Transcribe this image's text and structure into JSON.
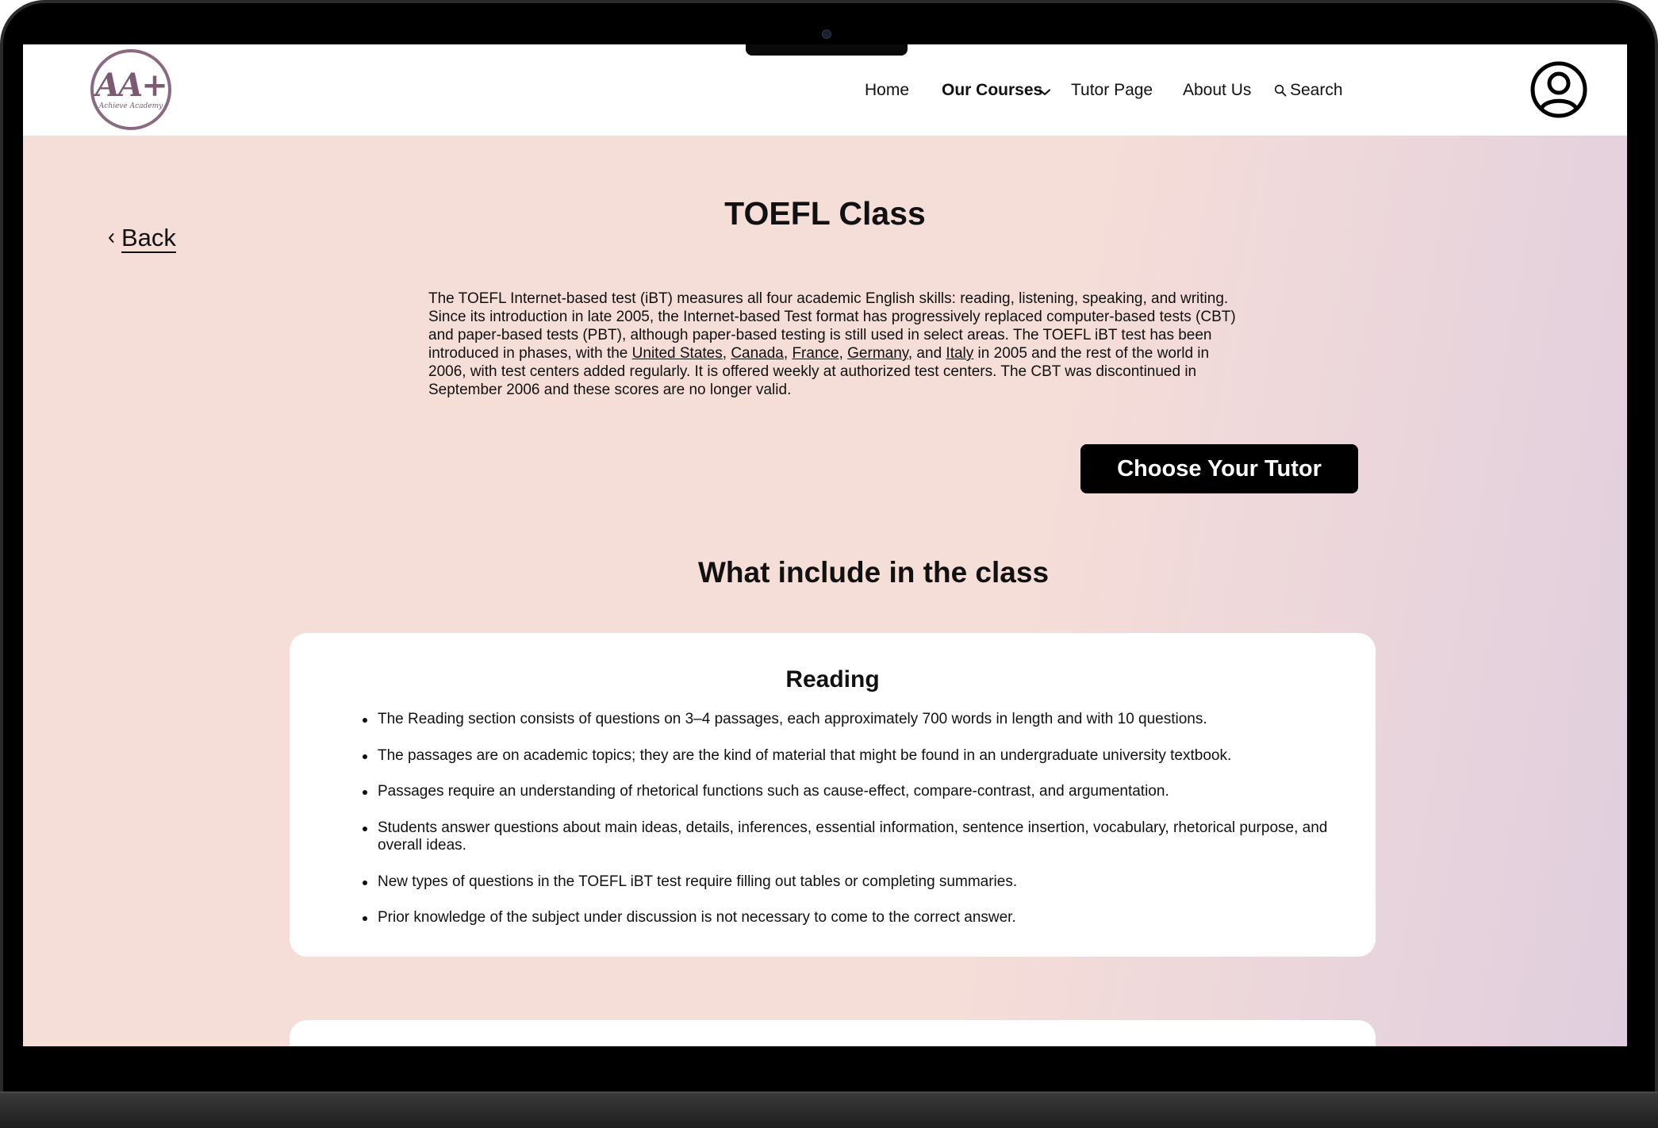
{
  "brand": {
    "logo_mark": "AA+",
    "logo_text": "Achieve Academy",
    "color": "#7b5a72"
  },
  "nav": {
    "home": "Home",
    "courses": "Our Courses",
    "tutor": "Tutor Page",
    "about": "About Us",
    "search": "Search",
    "icons": [
      "chevron-down-icon",
      "search-icon",
      "user-avatar-icon"
    ]
  },
  "page": {
    "back_label": "Back",
    "title": "TOEFL Class",
    "intro": {
      "part1": "The TOEFL Internet-based test (iBT) measures all four academic English skills: reading, listening, speaking, and writing. Since its introduction in late 2005, the Internet-based Test format has progressively replaced computer-based tests (CBT) and paper-based tests (PBT), although paper-based testing is still used in select areas. The TOEFL iBT test has been introduced in phases, with the ",
      "link_us": "United States",
      "sep1": ", ",
      "link_canada": "Canada",
      "sep2": ", ",
      "link_france": "France",
      "sep3": ", ",
      "link_germany": "Germany",
      "sep4": ", and ",
      "link_italy": "Italy",
      "part2": " in 2005 and the rest of the world in 2006, with test centers added regularly. It is offered weekly at authorized test centers. The CBT was discontinued in September 2006 and these scores are no longer valid."
    },
    "cta_label": "Choose Your Tutor",
    "section_title": "What include in the class",
    "reading_card": {
      "title": "Reading",
      "items": [
        "The Reading section consists of questions on 3–4 passages, each approximately 700 words in length and with 10 questions.",
        "The passages are on academic topics; they are the kind of material that might be found in an undergraduate university textbook.",
        " Passages require an understanding of rhetorical functions such as cause-effect, compare-contrast, and argumentation.",
        "Students answer questions about main ideas, details, inferences, essential information, sentence insertion, vocabulary, rhetorical purpose, and overall ideas.",
        " New types of questions in the TOEFL iBT test require filling out tables or completing summaries.",
        "Prior knowledge of the subject under discussion is not necessary to come to the correct answer."
      ]
    }
  },
  "colors": {
    "background_start": "#f5ddd8",
    "background_end": "#e0cede",
    "button": "#000000",
    "button_text": "#ffffff"
  }
}
